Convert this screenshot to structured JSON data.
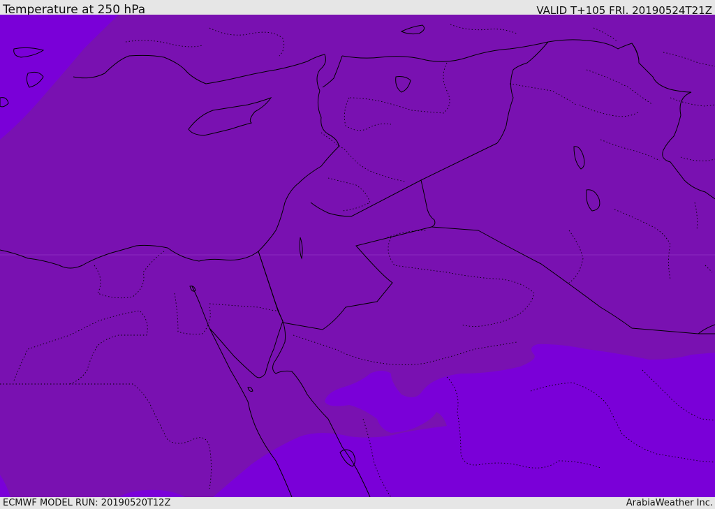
{
  "header": {
    "title": "Temperature at 250 hPa",
    "valid": "VALID T+105 FRI. 20190524T21Z"
  },
  "footer": {
    "model_run": "ECMWF MODEL RUN: 20190520T12Z",
    "credit": "ArabiaWeather Inc."
  },
  "map": {
    "colors": {
      "field_warm": "#7911b1",
      "field_cold": "#7a00d8",
      "border": "#000000",
      "frame": "#e6e6e6"
    }
  }
}
